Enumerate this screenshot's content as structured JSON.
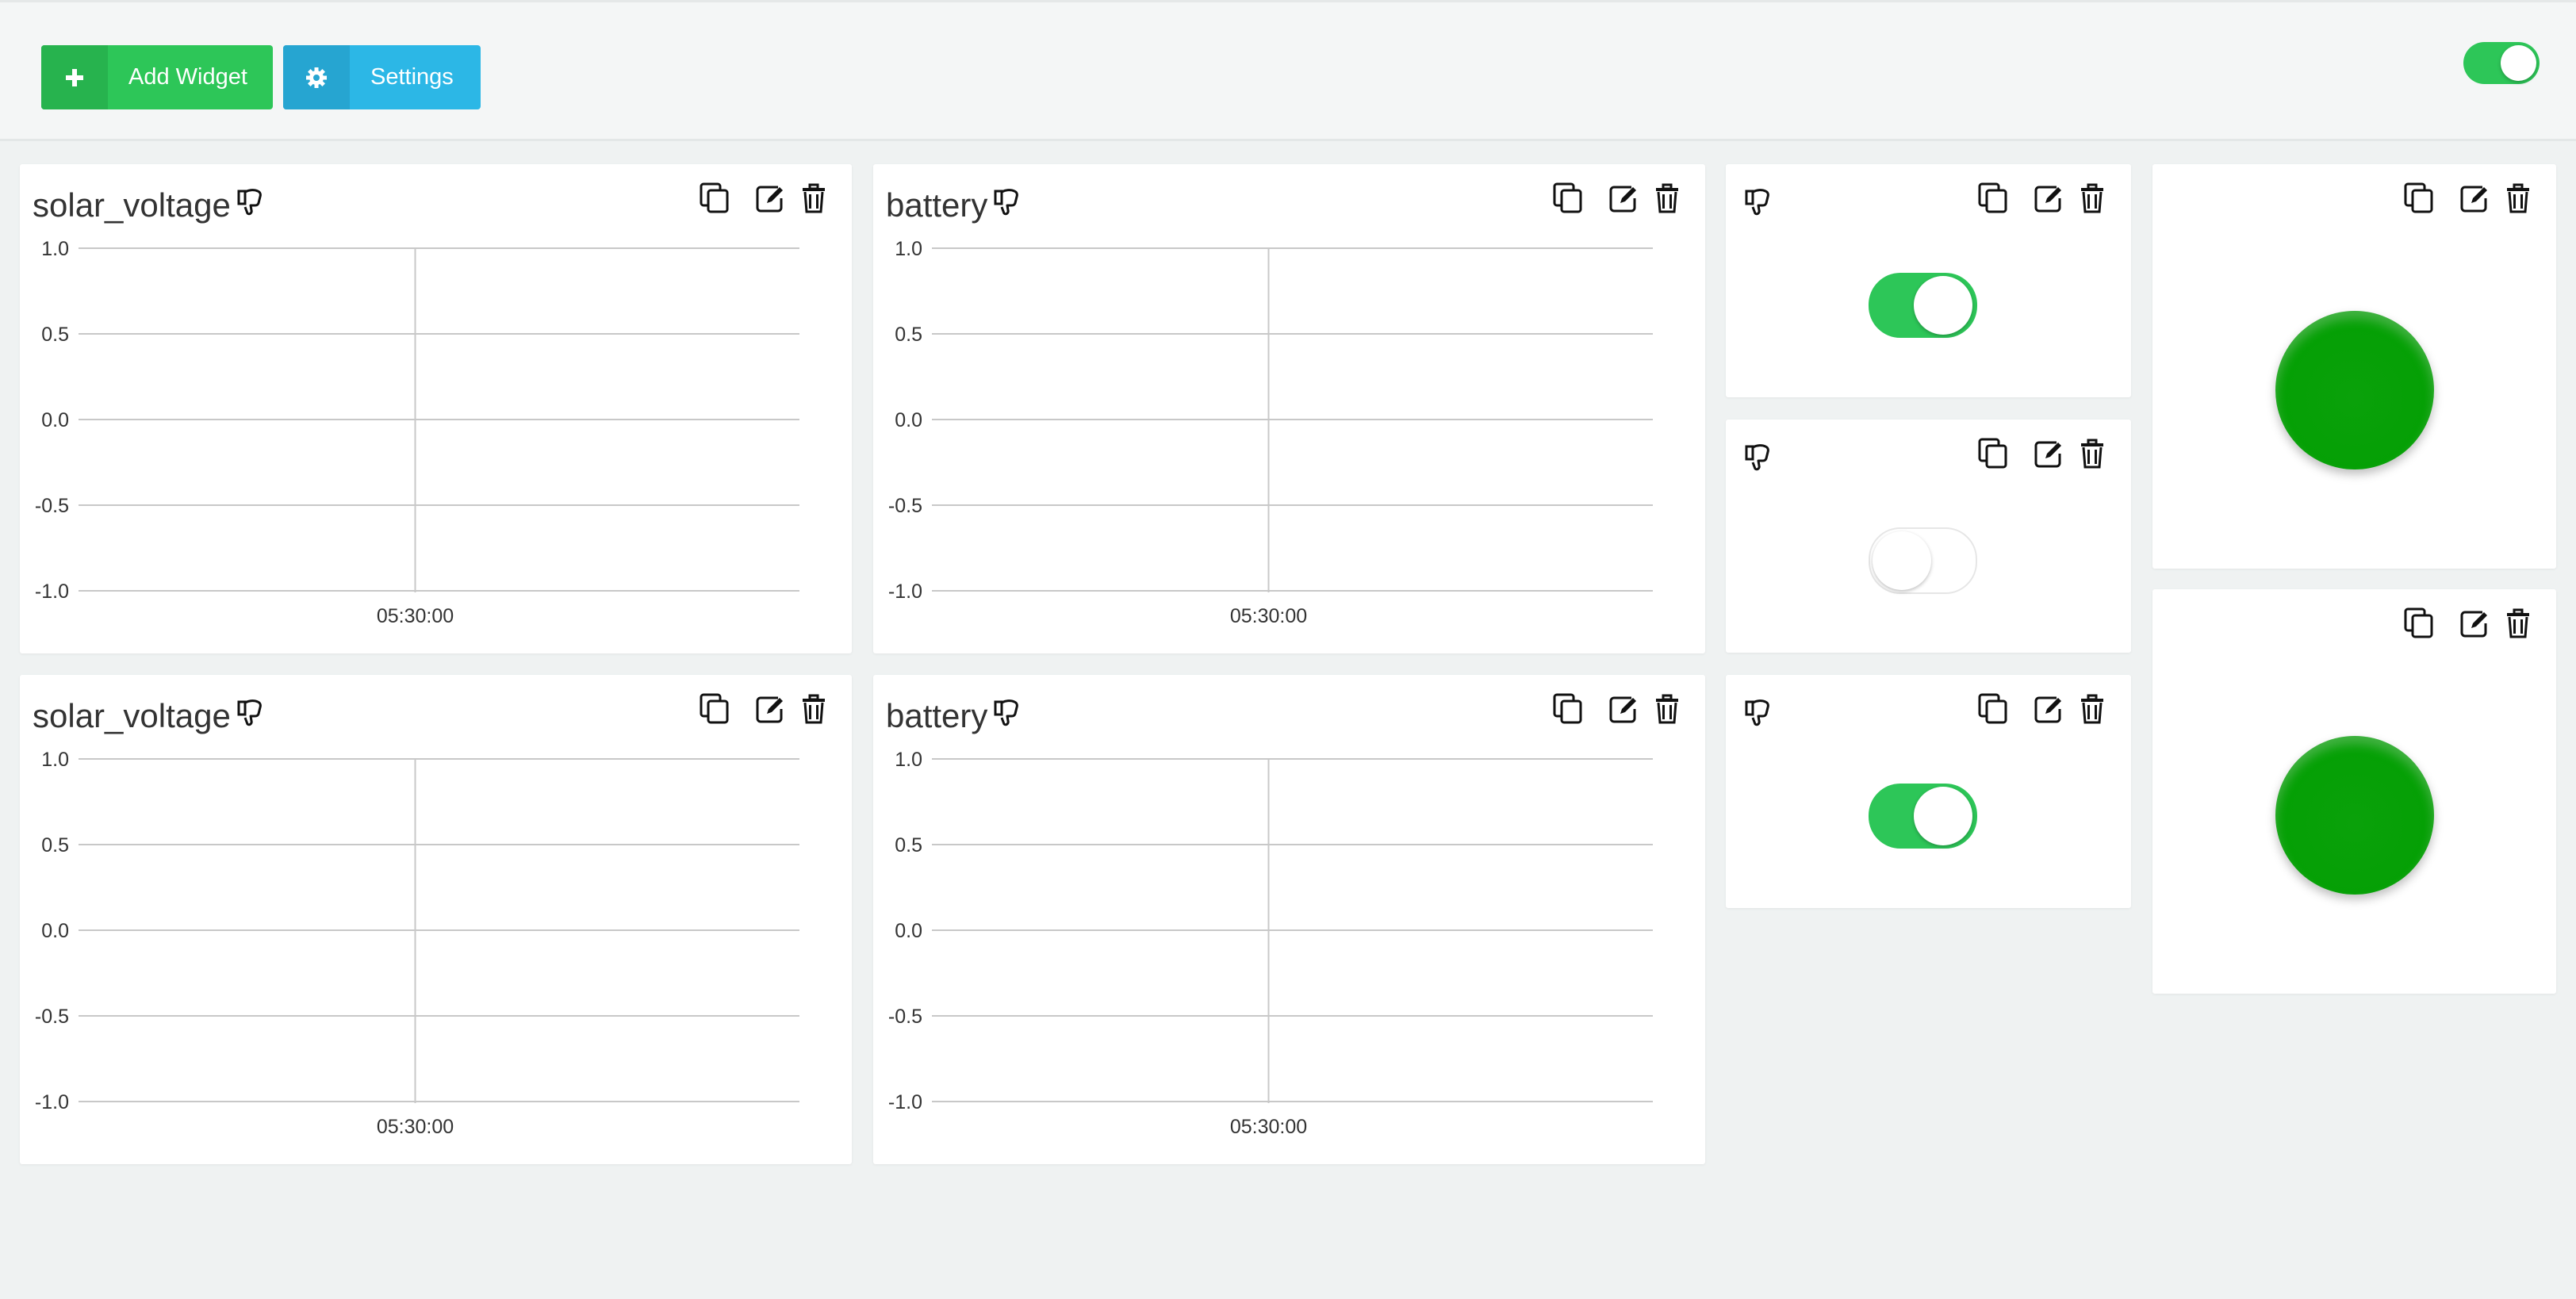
{
  "toolbar": {
    "add_widget_label": "Add Widget",
    "settings_label": "Settings",
    "edit_mode_on": true
  },
  "colors": {
    "accent_green": "#2dc658",
    "accent_blue": "#2cb7e6",
    "lamp_green": "#05a005"
  },
  "icons": {
    "plus": "plus-icon",
    "gear": "gear-icon",
    "copy": "copy-icon",
    "edit": "edit-icon",
    "delete": "trash-icon",
    "thumbs_down": "thumbs-down-icon"
  },
  "widgets": [
    {
      "title": "solar_voltage",
      "kind": "chart"
    },
    {
      "title": "battery",
      "kind": "chart"
    },
    {
      "title": "solar_voltage",
      "kind": "chart"
    },
    {
      "title": "battery",
      "kind": "chart"
    },
    {
      "kind": "switch",
      "state": true
    },
    {
      "kind": "switch",
      "state": false
    },
    {
      "kind": "switch",
      "state": true
    },
    {
      "kind": "lamp",
      "state": true
    },
    {
      "kind": "lamp",
      "state": true
    }
  ],
  "chart_data": [
    {
      "type": "line",
      "title": "solar_voltage",
      "x_ticks": [
        "05:30:00"
      ],
      "y_ticks": [
        "1.0",
        "0.5",
        "0.0",
        "-0.5",
        "-1.0"
      ],
      "ylim": [
        -1,
        1
      ],
      "grid": true,
      "series": []
    },
    {
      "type": "line",
      "title": "battery",
      "x_ticks": [
        "05:30:00"
      ],
      "y_ticks": [
        "1.0",
        "0.5",
        "0.0",
        "-0.5",
        "-1.0"
      ],
      "ylim": [
        -1,
        1
      ],
      "grid": true,
      "series": []
    },
    {
      "type": "line",
      "title": "solar_voltage",
      "x_ticks": [
        "05:30:00"
      ],
      "y_ticks": [
        "1.0",
        "0.5",
        "0.0",
        "-0.5",
        "-1.0"
      ],
      "ylim": [
        -1,
        1
      ],
      "grid": true,
      "series": []
    },
    {
      "type": "line",
      "title": "battery",
      "x_ticks": [
        "05:30:00"
      ],
      "y_ticks": [
        "1.0",
        "0.5",
        "0.0",
        "-0.5",
        "-1.0"
      ],
      "ylim": [
        -1,
        1
      ],
      "grid": true,
      "series": []
    }
  ]
}
